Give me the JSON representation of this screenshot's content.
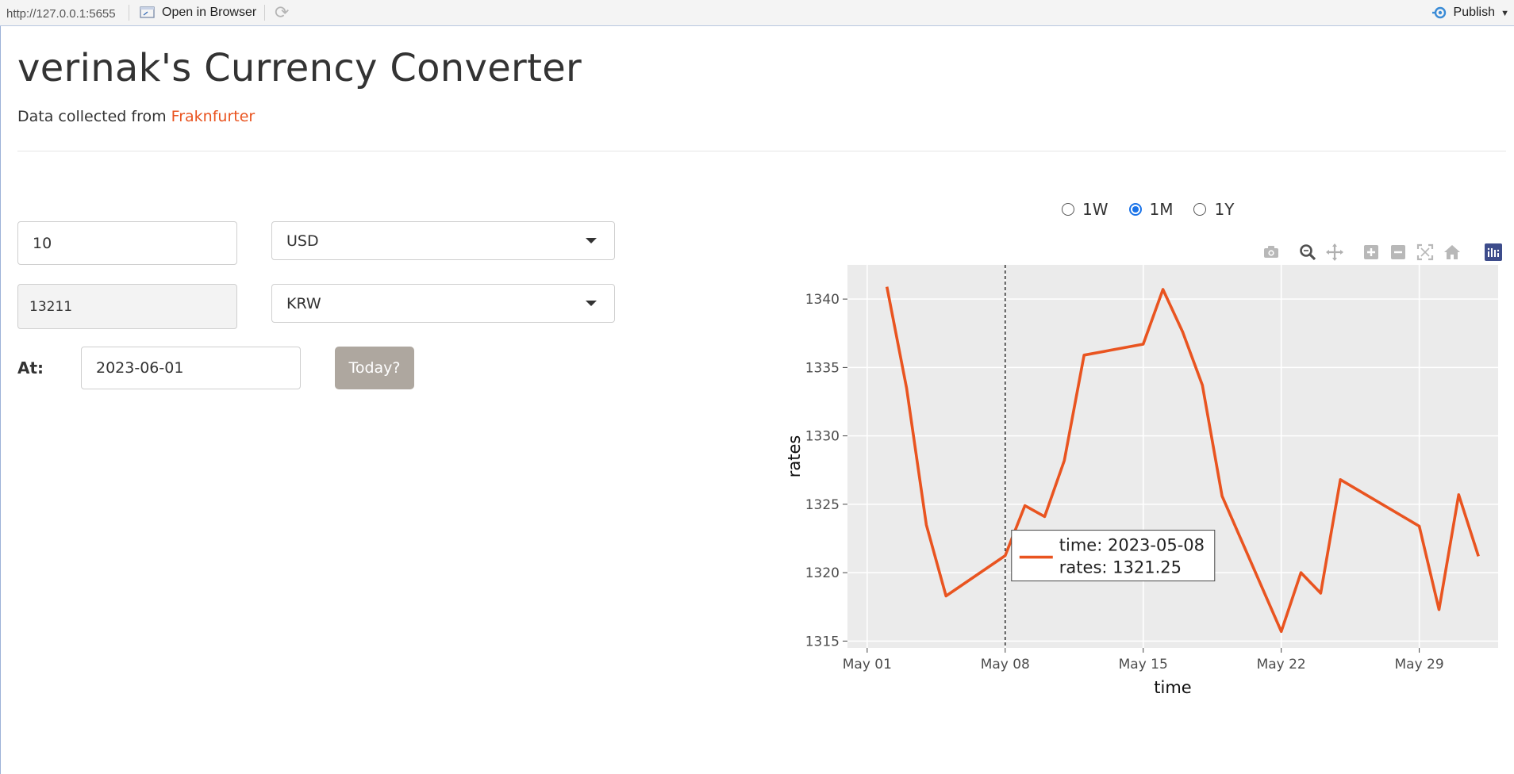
{
  "viewer": {
    "url": "http://127.0.0.1:5655",
    "open_label": "Open in Browser",
    "publish_label": "Publish"
  },
  "header": {
    "title": "verinak's Currency Converter",
    "source_prefix": "Data collected from",
    "source_link": "Fraknfurter"
  },
  "converter": {
    "amount": "10",
    "from_currency": "USD",
    "result": "13211",
    "to_currency": "KRW",
    "at_label": "At:",
    "date": "2023-06-01",
    "today_button": "Today?"
  },
  "range": {
    "options": [
      "1W",
      "1M",
      "1Y"
    ],
    "selected": "1M"
  },
  "modebar": [
    "camera-icon",
    "zoom-icon",
    "pan-icon",
    "zoom-in-icon",
    "zoom-out-icon",
    "autoscale-icon",
    "reset-axes-icon",
    "plotly-logo-icon"
  ],
  "chart_data": {
    "type": "line",
    "xlabel": "time",
    "ylabel": "rates",
    "ylim": [
      1314.5,
      1342.5
    ],
    "xlim": [
      "2023-04-30",
      "2023-06-02"
    ],
    "yticks": [
      1315,
      1320,
      1325,
      1330,
      1335,
      1340
    ],
    "xticks": [
      {
        "date": "2023-05-01",
        "label": "May 01"
      },
      {
        "date": "2023-05-08",
        "label": "May 08"
      },
      {
        "date": "2023-05-15",
        "label": "May 15"
      },
      {
        "date": "2023-05-22",
        "label": "May 22"
      },
      {
        "date": "2023-05-29",
        "label": "May 29"
      }
    ],
    "grid": true,
    "line_color": "#e95420",
    "plot_bg": "#ebebeb",
    "series": [
      {
        "x": [
          "2023-05-02",
          "2023-05-03",
          "2023-05-04",
          "2023-05-05",
          "2023-05-08",
          "2023-05-09",
          "2023-05-10",
          "2023-05-11",
          "2023-05-12",
          "2023-05-15",
          "2023-05-16",
          "2023-05-17",
          "2023-05-18",
          "2023-05-19",
          "2023-05-22",
          "2023-05-23",
          "2023-05-24",
          "2023-05-25",
          "2023-05-29",
          "2023-05-30",
          "2023-05-31",
          "2023-06-01"
        ],
        "values": [
          1340.9,
          1333.5,
          1323.5,
          1318.3,
          1321.25,
          1324.9,
          1324.1,
          1328.2,
          1335.9,
          1336.7,
          1340.7,
          1337.6,
          1333.7,
          1325.6,
          1315.7,
          1320.0,
          1318.5,
          1326.8,
          1323.4,
          1317.3,
          1325.7,
          1321.2
        ]
      }
    ],
    "hover": {
      "time_label": "time: 2023-05-08",
      "rates_label": "rates: 1321.25",
      "x": "2023-05-08",
      "y": 1321.25
    }
  }
}
